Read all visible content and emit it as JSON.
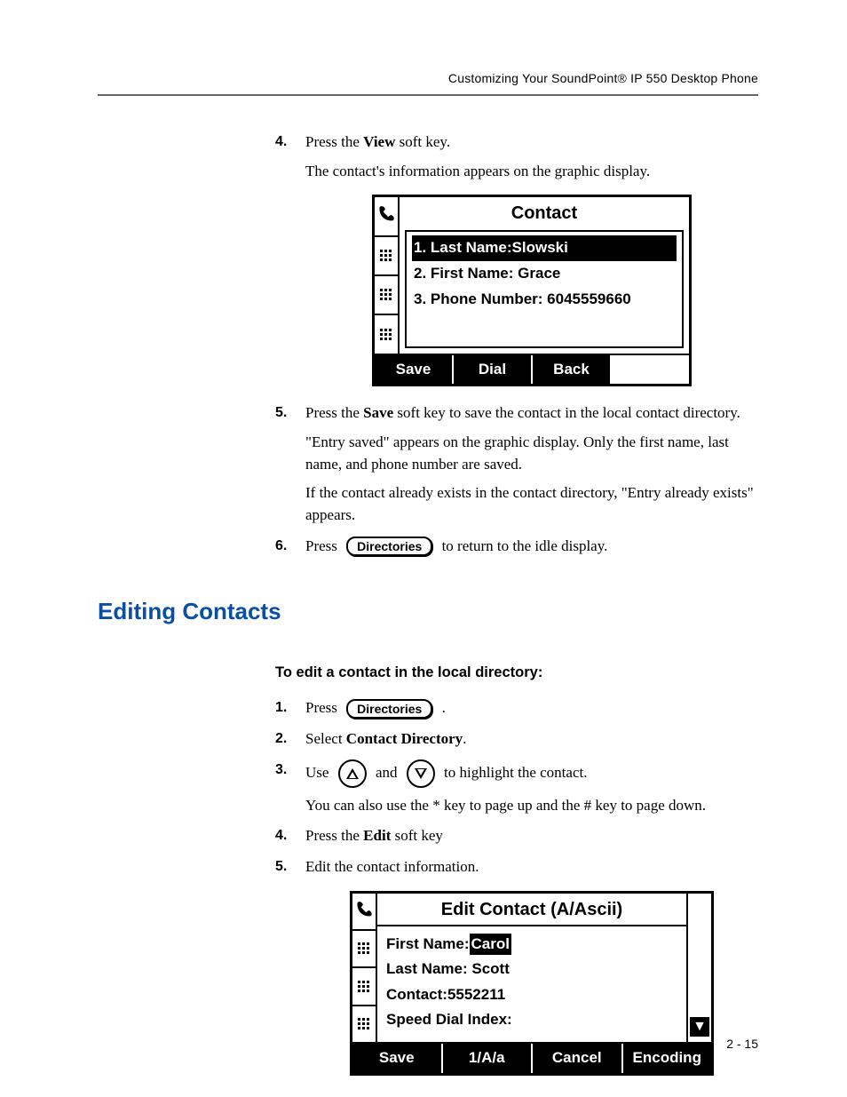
{
  "header": {
    "running_head": "Customizing Your SoundPoint® IP 550 Desktop Phone"
  },
  "steps_a": {
    "4": {
      "num": "4.",
      "line1_pre": "Press the ",
      "line1_bold": "View",
      "line1_post": " soft key.",
      "line2": "The contact's information appears on the graphic display."
    },
    "5": {
      "num": "5.",
      "line1_pre": "Press the ",
      "line1_bold": "Save",
      "line1_post": " soft key to save the contact in the local contact directory.",
      "line2": "\"Entry saved\" appears on the graphic display. Only the first name, last name, and phone number are saved.",
      "line3": "If the contact already exists in the contact directory, \"Entry already exists\" appears."
    },
    "6": {
      "num": "6.",
      "pre": "Press ",
      "key": "Directories",
      "post": " to return to the idle display."
    }
  },
  "lcd1": {
    "title": "Contact",
    "row1": "1. Last Name:Slowski",
    "row2": "2. First Name: Grace",
    "row3": "3. Phone Number: 6045559660",
    "soft1": "Save",
    "soft2": "Dial",
    "soft3": "Back"
  },
  "section": {
    "title": "Editing Contacts",
    "sub": "To edit a contact in the local directory:"
  },
  "steps_b": {
    "1": {
      "num": "1.",
      "pre": "Press ",
      "key": "Directories",
      "post": " ."
    },
    "2": {
      "num": "2.",
      "pre": "Select ",
      "bold": "Contact Directory",
      "post": "."
    },
    "3": {
      "num": "3.",
      "pre": "Use ",
      "mid": " and ",
      "post": " to highlight the contact.",
      "line2": "You can also use the * key to page up and the # key to page down."
    },
    "4": {
      "num": "4.",
      "pre": "Press the ",
      "bold": "Edit",
      "post": " soft key"
    },
    "5": {
      "num": "5.",
      "text": "Edit the contact information."
    }
  },
  "lcd2": {
    "title": "Edit Contact (A/Ascii)",
    "row1_label": "First Name:",
    "row1_value": "Carol",
    "row2": "Last Name: Scott",
    "row3": "Contact:5552211",
    "row4": "Speed Dial Index:",
    "soft1": "Save",
    "soft2": "1/A/a",
    "soft3": "Cancel",
    "soft4": "Encoding"
  },
  "footer": {
    "page": "2 - 15"
  }
}
